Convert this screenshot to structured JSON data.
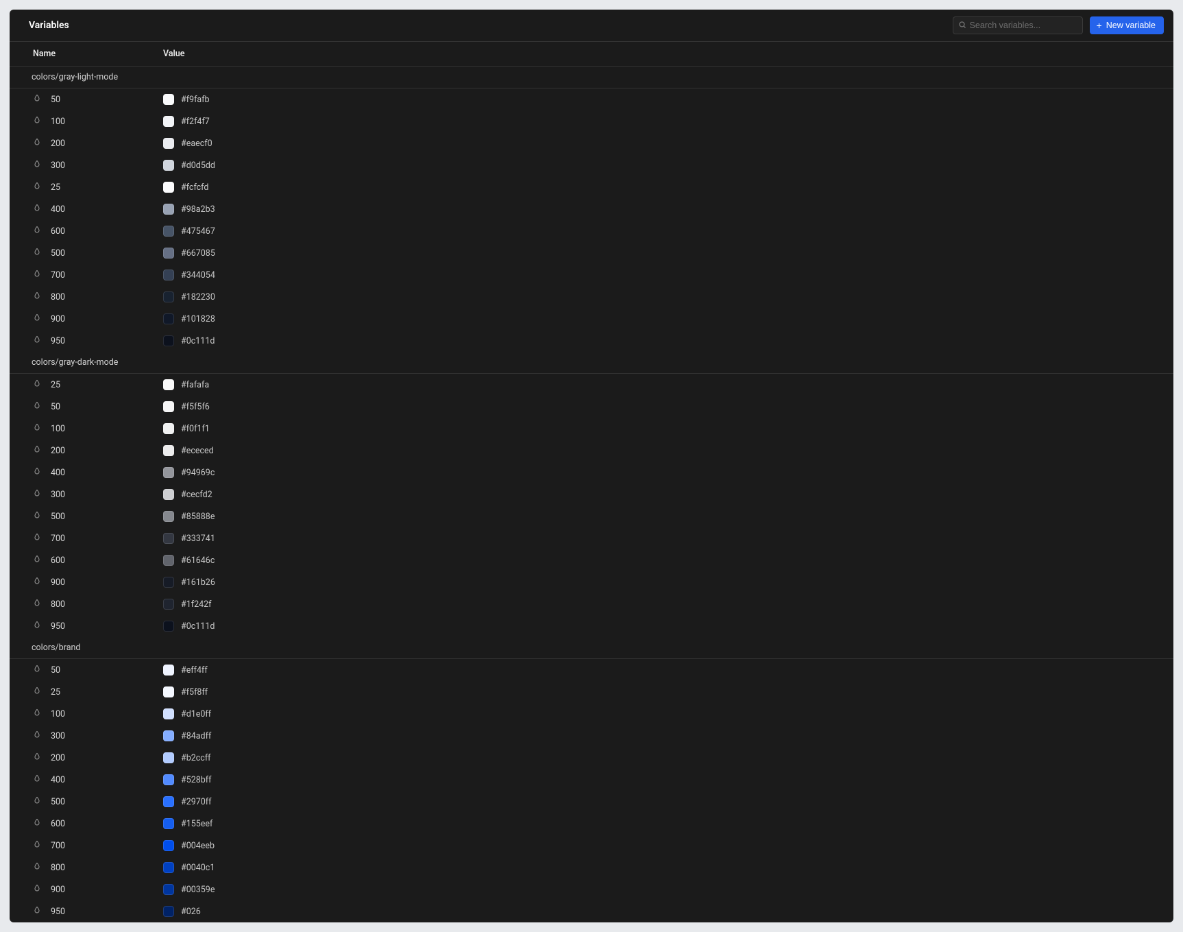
{
  "header": {
    "title": "Variables",
    "search_placeholder": "Search variables...",
    "new_button_label": "New variable"
  },
  "columns": {
    "name": "Name",
    "value": "Value"
  },
  "groups": [
    {
      "label": "colors/gray-light-mode",
      "rows": [
        {
          "name": "50",
          "hex": "#f9fafb"
        },
        {
          "name": "100",
          "hex": "#f2f4f7"
        },
        {
          "name": "200",
          "hex": "#eaecf0"
        },
        {
          "name": "300",
          "hex": "#d0d5dd"
        },
        {
          "name": "25",
          "hex": "#fcfcfd"
        },
        {
          "name": "400",
          "hex": "#98a2b3"
        },
        {
          "name": "600",
          "hex": "#475467"
        },
        {
          "name": "500",
          "hex": "#667085"
        },
        {
          "name": "700",
          "hex": "#344054"
        },
        {
          "name": "800",
          "hex": "#182230"
        },
        {
          "name": "900",
          "hex": "#101828"
        },
        {
          "name": "950",
          "hex": "#0c111d"
        }
      ]
    },
    {
      "label": "colors/gray-dark-mode",
      "rows": [
        {
          "name": "25",
          "hex": "#fafafa"
        },
        {
          "name": "50",
          "hex": "#f5f5f6"
        },
        {
          "name": "100",
          "hex": "#f0f1f1"
        },
        {
          "name": "200",
          "hex": "#ececed"
        },
        {
          "name": "400",
          "hex": "#94969c"
        },
        {
          "name": "300",
          "hex": "#cecfd2"
        },
        {
          "name": "500",
          "hex": "#85888e"
        },
        {
          "name": "700",
          "hex": "#333741"
        },
        {
          "name": "600",
          "hex": "#61646c"
        },
        {
          "name": "900",
          "hex": "#161b26"
        },
        {
          "name": "800",
          "hex": "#1f242f"
        },
        {
          "name": "950",
          "hex": "#0c111d"
        }
      ]
    },
    {
      "label": "colors/brand",
      "rows": [
        {
          "name": "50",
          "hex": "#eff4ff"
        },
        {
          "name": "25",
          "hex": "#f5f8ff"
        },
        {
          "name": "100",
          "hex": "#d1e0ff"
        },
        {
          "name": "300",
          "hex": "#84adff"
        },
        {
          "name": "200",
          "hex": "#b2ccff"
        },
        {
          "name": "400",
          "hex": "#528bff"
        },
        {
          "name": "500",
          "hex": "#2970ff"
        },
        {
          "name": "600",
          "hex": "#155eef"
        },
        {
          "name": "700",
          "hex": "#004eeb"
        },
        {
          "name": "800",
          "hex": "#0040c1"
        },
        {
          "name": "900",
          "hex": "#00359e"
        },
        {
          "name": "950",
          "hex": "#026"
        }
      ]
    }
  ]
}
